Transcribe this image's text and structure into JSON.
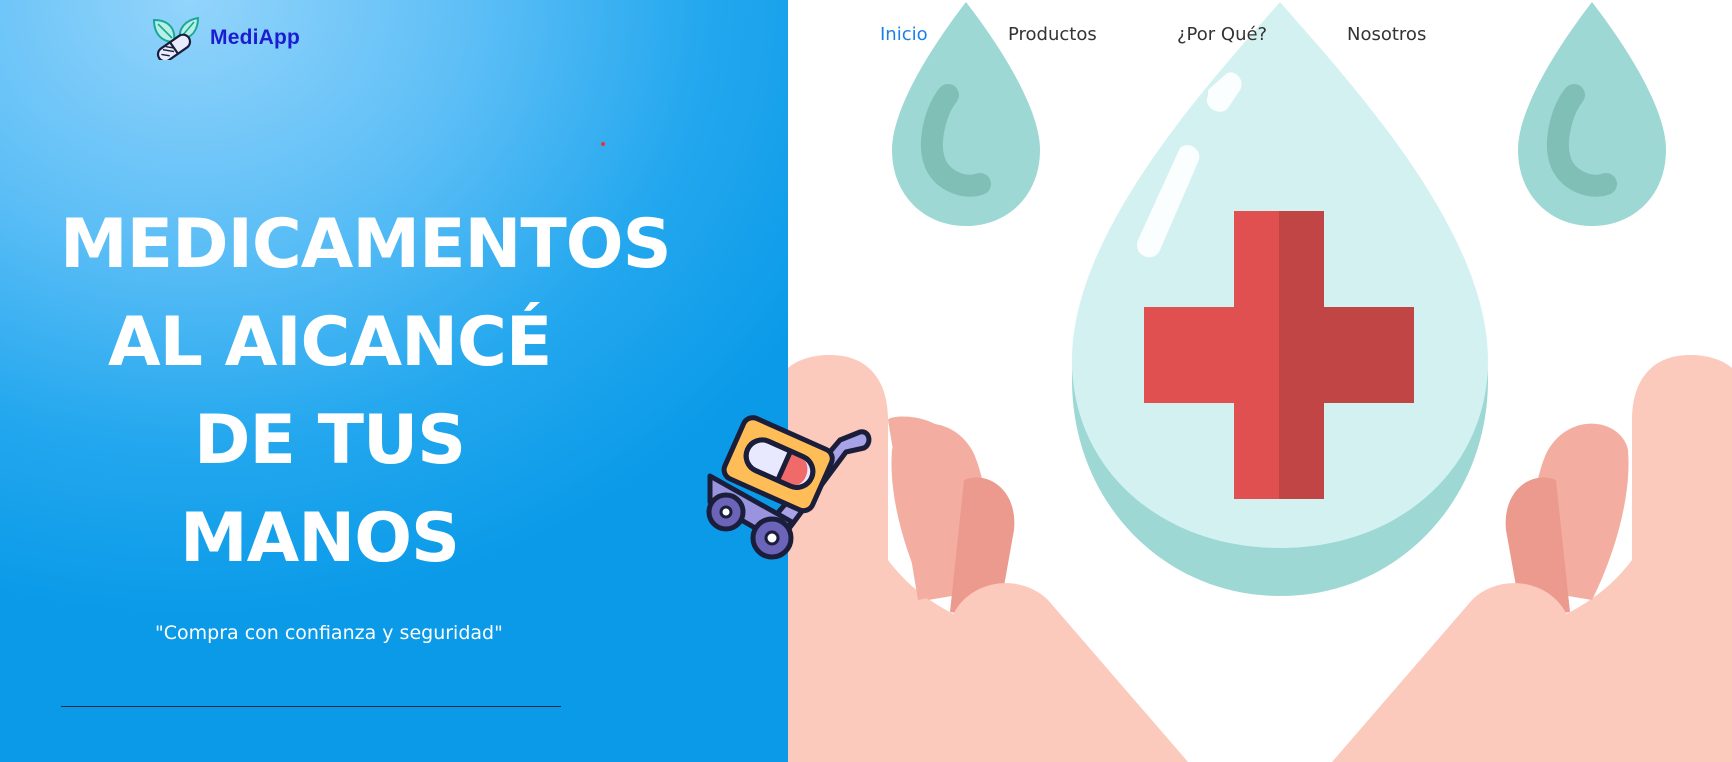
{
  "brand": {
    "name": "MediApp",
    "logo_icon": "capsule-leaves-icon"
  },
  "nav": {
    "items": [
      {
        "label": "Inicio",
        "active": true
      },
      {
        "label": "Productos",
        "active": false
      },
      {
        "label": "¿Por Qué?",
        "active": false
      },
      {
        "label": "Nosotros",
        "active": false
      }
    ],
    "active_color": "#1a7fe8"
  },
  "hero": {
    "headline_lines": [
      "MEDICAMENTOS",
      "AL AICANCÉ",
      "DE TUS",
      "MANOS"
    ],
    "tagline": "\"Compra con confianza y seguridad\"",
    "cart_icon": "pill-cart-icon",
    "illustration": "hands-holding-drop-cross-illustration"
  },
  "colors": {
    "hero_gradient_light": "#93d4fb",
    "hero_gradient_dark": "#0a9ae8",
    "brand": "#1c1dd1",
    "cross_red": "#e05050",
    "drop_teal": "#9dd8d4",
    "hand_pink": "#fcc9bd"
  }
}
